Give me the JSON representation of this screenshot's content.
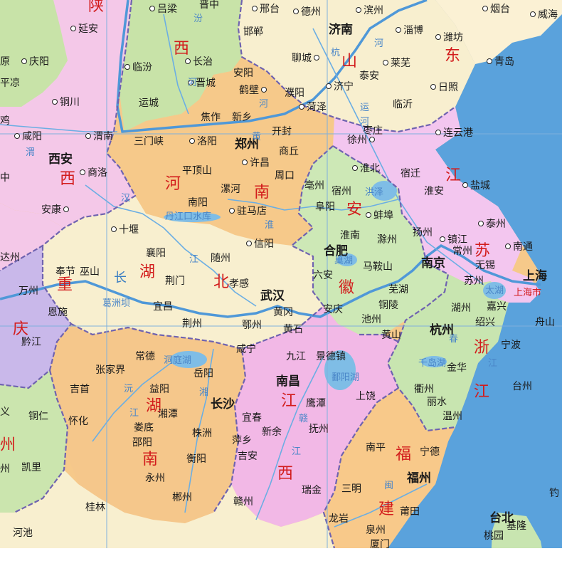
{
  "colors": {
    "sea": "#5aa2dc",
    "beijing_shanxi_green": "#c8e3a8",
    "shaanxi_pink": "#f4c8e8",
    "henan_orange": "#f6c98a",
    "hubei_cream": "#f8efcf",
    "anhui_green": "#cde8b6",
    "jiangsu_pink": "#f3c6ef",
    "shandong_cream": "#fbf1d4",
    "zhejiang_green": "#c8e5b0",
    "jiangxi_pink": "#f2b8e6",
    "hunan_orange": "#f5c78b",
    "fujian_orange": "#f8c98a",
    "chongqing_purple": "#c9b8ea",
    "guizhou_green": "#cbe5ae",
    "river": "#5aa2dc",
    "border": "#6f63b0",
    "province_label": "#d21c1c"
  },
  "provinces": {
    "shaanxi_1": "陕",
    "shanxi_1": "山",
    "shanxi_2": "西",
    "shandong_1": "山",
    "shandong_2": "东",
    "shaanxi_2": "西",
    "henan_1": "河",
    "henan_2": "南",
    "anhui_1": "安",
    "anhui_2": "徽",
    "jiangsu_1": "江",
    "jiangsu_2": "苏",
    "hubei_1": "湖",
    "hubei_2": "北",
    "chongqing_1": "重",
    "chongqing_2": "庆",
    "zhejiang_1": "浙",
    "zhejiang_2": "江",
    "jiangxi_1": "江",
    "jiangxi_2": "西",
    "hunan_1": "湖",
    "hunan_2": "南",
    "fujian_1": "福",
    "fujian_2": "建",
    "guizhou_1": "州"
  },
  "capitals": {
    "jinan": "济南",
    "zhengzhou": "郑州",
    "xian": "西安",
    "hefei": "合肥",
    "nanjing": "南京",
    "wuhan": "武汉",
    "hangzhou": "杭州",
    "nanchang": "南昌",
    "changsha": "长沙",
    "fuzhou": "福州",
    "taibei": "台北",
    "shanghai": "上海"
  },
  "cities": {
    "yanan": "延安",
    "qingyang": "庆阳",
    "pingliang": "平凉",
    "tongchuan": "铜川",
    "xianyang": "咸阳",
    "weinan": "渭南",
    "baoji": "鸡",
    "shangluo": "商洛",
    "ankang": "安康",
    "lvliang": "吕梁",
    "jinzhong": "晋中",
    "linfen": "临汾",
    "changzhi": "长治",
    "jincheng": "晋城",
    "yuncheng": "运城",
    "xingtai": "邢台",
    "handan": "邯郸",
    "anyang": "安阳",
    "hebi": "鹤壁",
    "jiaozuo": "焦作",
    "xinxiang": "新乡",
    "puyang": "濮阳",
    "dezhou": "德州",
    "binzhou": "滨州",
    "zibo": "淄博",
    "weifang": "潍坊",
    "yantai": "烟台",
    "weihai": "威海",
    "qingdao": "青岛",
    "liaocheng": "聊城",
    "laiwu": "莱芜",
    "taian": "泰安",
    "jining": "济宁",
    "rizhao": "日照",
    "linyi": "临沂",
    "heze": "菏泽",
    "zaozhuang": "枣庄",
    "lianyungang": "连云港",
    "sanmenxia": "三门峡",
    "luoyang": "洛阳",
    "kaifeng": "开封",
    "shangqiu": "商丘",
    "xuzhou": "徐州",
    "pingdingshan": "平顶山",
    "xuchang": "许昌",
    "zhoukou": "周口",
    "huaibei": "淮北",
    "suqian": "宿迁",
    "huaian": "淮安",
    "yancheng": "盐城",
    "nanyang": "南阳",
    "luohe": "漯河",
    "bozhou": "亳州",
    "suzhou_ah": "宿州",
    "zhumadian": "驻马店",
    "fuyang": "阜阳",
    "bengbu": "蚌埠",
    "yangzhou": "扬州",
    "taizhou_js": "泰州",
    "shiyan": "十堰",
    "xinyang": "信阳",
    "huainan": "淮南",
    "chuzhou": "滁州",
    "zhenjiang": "镇江",
    "changzhou": "常州",
    "nantong": "南通",
    "xiangyang": "襄阳",
    "suizhou": "随州",
    "wuxi": "无锡",
    "maanshan": "马鞍山",
    "dazhou": "达州",
    "fengjie": "奉节",
    "wushan": "巫山",
    "jingmen": "荆门",
    "xiaogan": "孝感",
    "liuan": "六安",
    "wuhu": "芜湖",
    "suzhou_js": "苏州",
    "wanzhou": "万州",
    "yichang": "宜昌",
    "huanggang": "黄冈",
    "tongling": "铜陵",
    "huzhou": "湖州",
    "jiaxing": "嘉兴",
    "enshi": "恩施",
    "anqing": "安庆",
    "chizhou": "池州",
    "jingzhou": "荆州",
    "ezhou": "鄂州",
    "huangshi": "黄石",
    "shaoxing": "绍兴",
    "zhoushan": "舟山",
    "qianjiang": "黔江",
    "huangshan": "黄山",
    "ningbo": "宁波",
    "xianning": "咸宁",
    "jiujiang": "九江",
    "jingdezhen": "景德镇",
    "changde": "常德",
    "zhangjiajie": "张家界",
    "yueyang": "岳阳",
    "jinhua": "金华",
    "jishou": "吉首",
    "yiyang": "益阳",
    "quzhou": "衢州",
    "lishui": "丽水",
    "taizhou_zj": "台州",
    "tongren": "铜仁",
    "xiangtan": "湘潭",
    "yingtan": "鹰潭",
    "shangrao": "上饶",
    "huaihua": "怀化",
    "loudi": "娄底",
    "zhuzhou": "株洲",
    "yichun": "宜春",
    "xinyu": "新余",
    "fuzhou_jx": "抚州",
    "wenzhou": "温州",
    "shaoyang": "邵阳",
    "pingxiang": "萍乡",
    "hengyang": "衡阳",
    "jian": "吉安",
    "nanping": "南平",
    "ningde": "宁德",
    "kaili": "凯里",
    "yongzhou": "永州",
    "chenzhou": "郴州",
    "ganzhou": "赣州",
    "ruijin": "瑞金",
    "sanming": "三明",
    "guilin": "桂林",
    "putian": "莆田",
    "longyan": "龙岩",
    "quanzhou": "泉州",
    "hechi": "河池",
    "xiamen": "厦门",
    "taoyuan": "桃园",
    "jilong": "基隆",
    "yuan": "原",
    "zhong": "中",
    "yi": "义",
    "zhou": "州",
    "diaoyu": "钓"
  },
  "water": {
    "yellow_river": "黄",
    "yellow_river_2": "河",
    "canal_1": "运",
    "canal_2": "河",
    "grand_canal_1": "杭",
    "han_river": "汉",
    "danjiangkou": "丹江口水库",
    "yangtze_1": "长",
    "yangtze_2": "江",
    "hongze": "洪泽",
    "chaohu": "巢湖",
    "taihu": "太湖",
    "huai": "淮",
    "gezhouba": "葛洲坝",
    "dongting": "洞庭湖",
    "poyang": "鄱阳湖",
    "qiandao": "千岛湖",
    "yuan": "沅",
    "xiang": "湘",
    "gan": "赣",
    "fen": "汾",
    "wei": "渭",
    "jiang_xiang": "江",
    "min": "闽",
    "he_1": "河",
    "he_2": "河",
    "jiang_1": "江",
    "jiang_2": "江",
    "jiang_3": "江",
    "chun": "春",
    "shanghai_city": "上海市"
  }
}
